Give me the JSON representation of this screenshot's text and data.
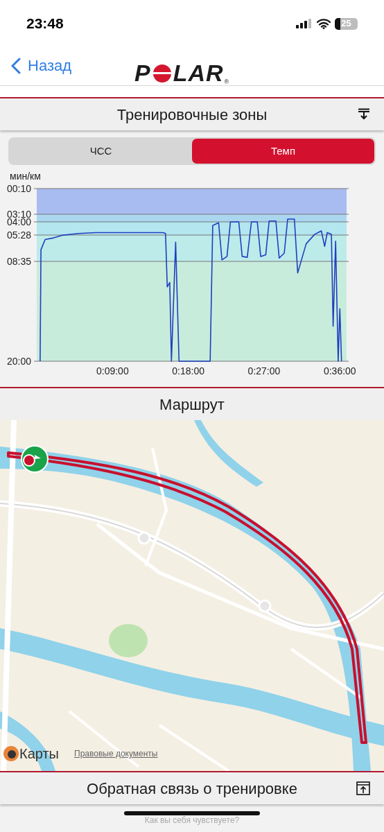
{
  "status_bar": {
    "time": "23:48",
    "battery": "25"
  },
  "nav": {
    "back": "Назад",
    "logo": {
      "before": "P",
      "after": "LAR",
      "mark": "®"
    }
  },
  "zones_section": {
    "title": "Тренировочные зоны",
    "tabs": [
      {
        "label": "ЧСС",
        "selected": false
      },
      {
        "label": "Темп",
        "selected": true
      }
    ],
    "chart_data": {
      "type": "line",
      "ylabel": "мин/км",
      "xlim": [
        0,
        36.8
      ],
      "ylim": [
        20,
        0.1667
      ],
      "grid": true,
      "bands": [
        {
          "axis": "y",
          "from": 0.1667,
          "to": 3.1667,
          "color": "#a9bcf1"
        },
        {
          "axis": "y",
          "from": 3.1667,
          "to": 4,
          "color": "#abd6f0"
        },
        {
          "axis": "y",
          "from": 4,
          "to": 5.4667,
          "color": "#b3e6ef"
        },
        {
          "axis": "y",
          "from": 5.4667,
          "to": 8.5833,
          "color": "#bcebea"
        },
        {
          "axis": "y",
          "from": 8.5833,
          "to": 20,
          "color": "#c8ecdc"
        }
      ],
      "xticks": [
        {
          "value": 9,
          "label": "0:09:00"
        },
        {
          "value": 18,
          "label": "0:18:00"
        },
        {
          "value": 27,
          "label": "0:27:00"
        },
        {
          "value": 36,
          "label": "0:36:00"
        }
      ],
      "yticks": [
        {
          "value": 0.1667,
          "label": "00:10"
        },
        {
          "value": 3.1667,
          "label": "03:10"
        },
        {
          "value": 4,
          "label": "04:00"
        },
        {
          "value": 5.4667,
          "label": "05:28"
        },
        {
          "value": 8.5833,
          "label": "08:35"
        },
        {
          "value": 20,
          "label": "20:00"
        }
      ],
      "x": [
        0.4,
        0.5,
        1,
        2,
        3,
        5,
        7,
        9,
        11,
        13,
        15,
        15.3,
        15.5,
        15.8,
        16,
        16.5,
        16.9,
        20.6,
        20.9,
        21.6,
        22,
        22.6,
        23,
        24,
        24.4,
        25,
        25.5,
        26.2,
        26.6,
        27.2,
        27.6,
        28.4,
        28.8,
        29.4,
        29.8,
        30.6,
        31,
        32,
        33,
        33.8,
        34.2,
        34.5,
        35,
        35.2,
        35.5,
        35.8,
        36,
        36.2
      ],
      "series": [
        {
          "color": "#1f3fbf",
          "values": [
            20,
            7.2,
            6.0,
            5.8,
            5.5,
            5.3,
            5.2,
            5.2,
            5.2,
            5.2,
            5.2,
            5.3,
            11.5,
            11,
            20,
            6.3,
            20,
            20,
            4.4,
            4.1,
            8.4,
            8.0,
            4.0,
            4.0,
            8.0,
            8.1,
            4.0,
            4.0,
            8.0,
            7.8,
            3.9,
            3.9,
            8.2,
            7.6,
            3.7,
            3.7,
            9.9,
            6.5,
            5.4,
            5.0,
            6.8,
            5.2,
            5.4,
            16,
            6.2,
            20,
            14,
            20
          ]
        }
      ]
    }
  },
  "route_section": {
    "title": "Маршрут",
    "map": {
      "kind": "picture",
      "brand": "Карты",
      "legal_link": "Правовые документы"
    }
  },
  "feedback_section": {
    "title": "Обратная связь о тренировке",
    "next_prompt": "Как вы себя чувствуете?"
  }
}
